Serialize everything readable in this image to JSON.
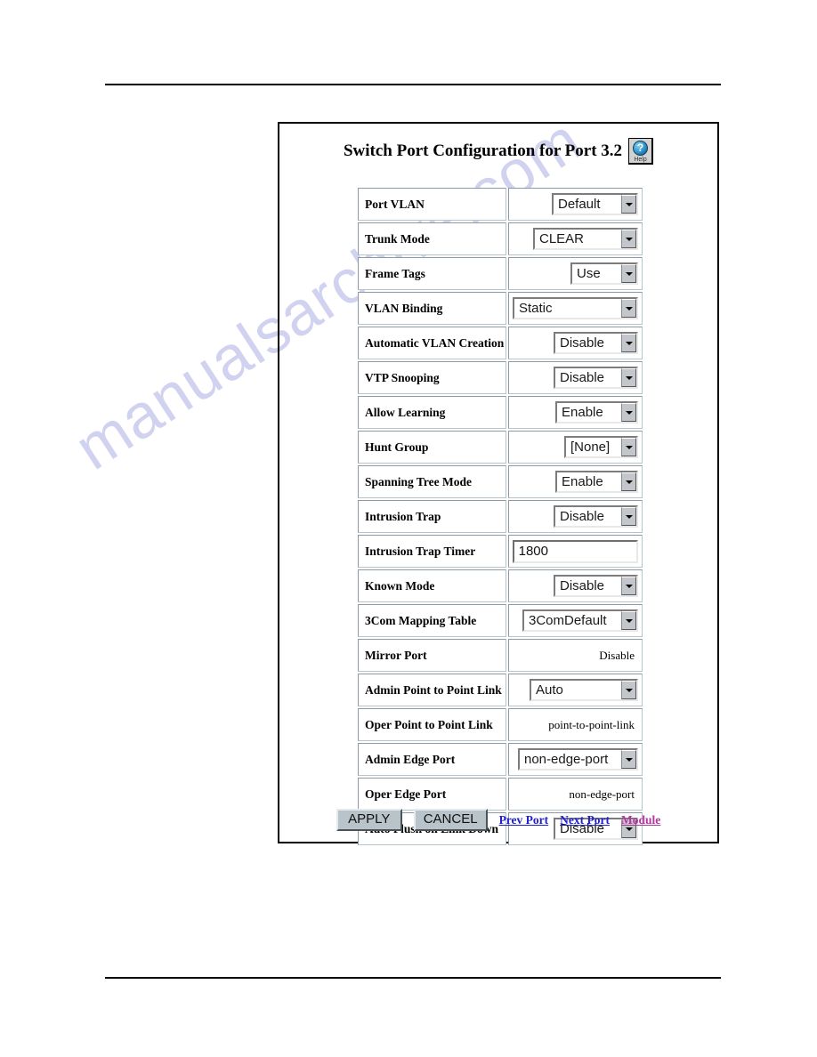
{
  "document": {
    "watermark_text": "manualsarchive.com",
    "watermark_color": "#c9cbee"
  },
  "screen": {
    "title": "Switch Port Configuration for Port 3.2",
    "help_button": {
      "glyph": "?",
      "caption": "Help",
      "icon_name": "help-question-globe-icon"
    },
    "rows": [
      {
        "label": "Port VLAN",
        "control": "select",
        "value": "Default",
        "width_class": "w-default"
      },
      {
        "label": "Trunk Mode",
        "control": "select",
        "value": "CLEAR",
        "width_class": "w-clear"
      },
      {
        "label": "Frame Tags",
        "control": "select",
        "value": "Use",
        "width_class": "w-use"
      },
      {
        "label": "VLAN Binding",
        "control": "select",
        "value": "Static",
        "width_class": "w-static"
      },
      {
        "label": "Automatic VLAN Creation",
        "control": "select",
        "value": "Disable",
        "width_class": "w-disable"
      },
      {
        "label": "VTP Snooping",
        "control": "select",
        "value": "Disable",
        "width_class": "w-disable"
      },
      {
        "label": "Allow Learning",
        "control": "select",
        "value": "Enable",
        "width_class": "w-enable"
      },
      {
        "label": "Hunt Group",
        "control": "select",
        "value": "[None]",
        "width_class": "w-none"
      },
      {
        "label": "Spanning Tree Mode",
        "control": "select",
        "value": "Enable",
        "width_class": "w-enable"
      },
      {
        "label": "Intrusion Trap",
        "control": "select",
        "value": "Disable",
        "width_class": "w-disable"
      },
      {
        "label": "Intrusion Trap Timer",
        "control": "text",
        "value": "1800",
        "width_class": ""
      },
      {
        "label": "Known Mode",
        "control": "select",
        "value": "Disable",
        "width_class": "w-disable"
      },
      {
        "label": "3Com Mapping Table",
        "control": "select",
        "value": "3ComDefault",
        "width_class": "w-3com"
      },
      {
        "label": "Mirror Port",
        "control": "readonly",
        "value": "Disable",
        "width_class": ""
      },
      {
        "label": "Admin Point to Point Link",
        "control": "select",
        "value": "Auto",
        "width_class": "w-auto"
      },
      {
        "label": "Oper Point to Point Link",
        "control": "readonly",
        "value": "point-to-point-link",
        "width_class": ""
      },
      {
        "label": "Admin Edge Port",
        "control": "select",
        "value": "non-edge-port",
        "width_class": "w-nonedge"
      },
      {
        "label": "Oper Edge Port",
        "control": "readonly",
        "value": "non-edge-port",
        "width_class": ""
      },
      {
        "label": "Auto Flush on Link Down",
        "control": "select",
        "value": "Disable",
        "width_class": "w-disable"
      }
    ],
    "footer": {
      "apply_label": "APPLY",
      "cancel_label": "CANCEL",
      "links": [
        {
          "label": "Prev Port",
          "state": "unvisited"
        },
        {
          "label": "Next Port",
          "state": "unvisited"
        },
        {
          "label": "Module",
          "state": "visited"
        }
      ]
    }
  }
}
